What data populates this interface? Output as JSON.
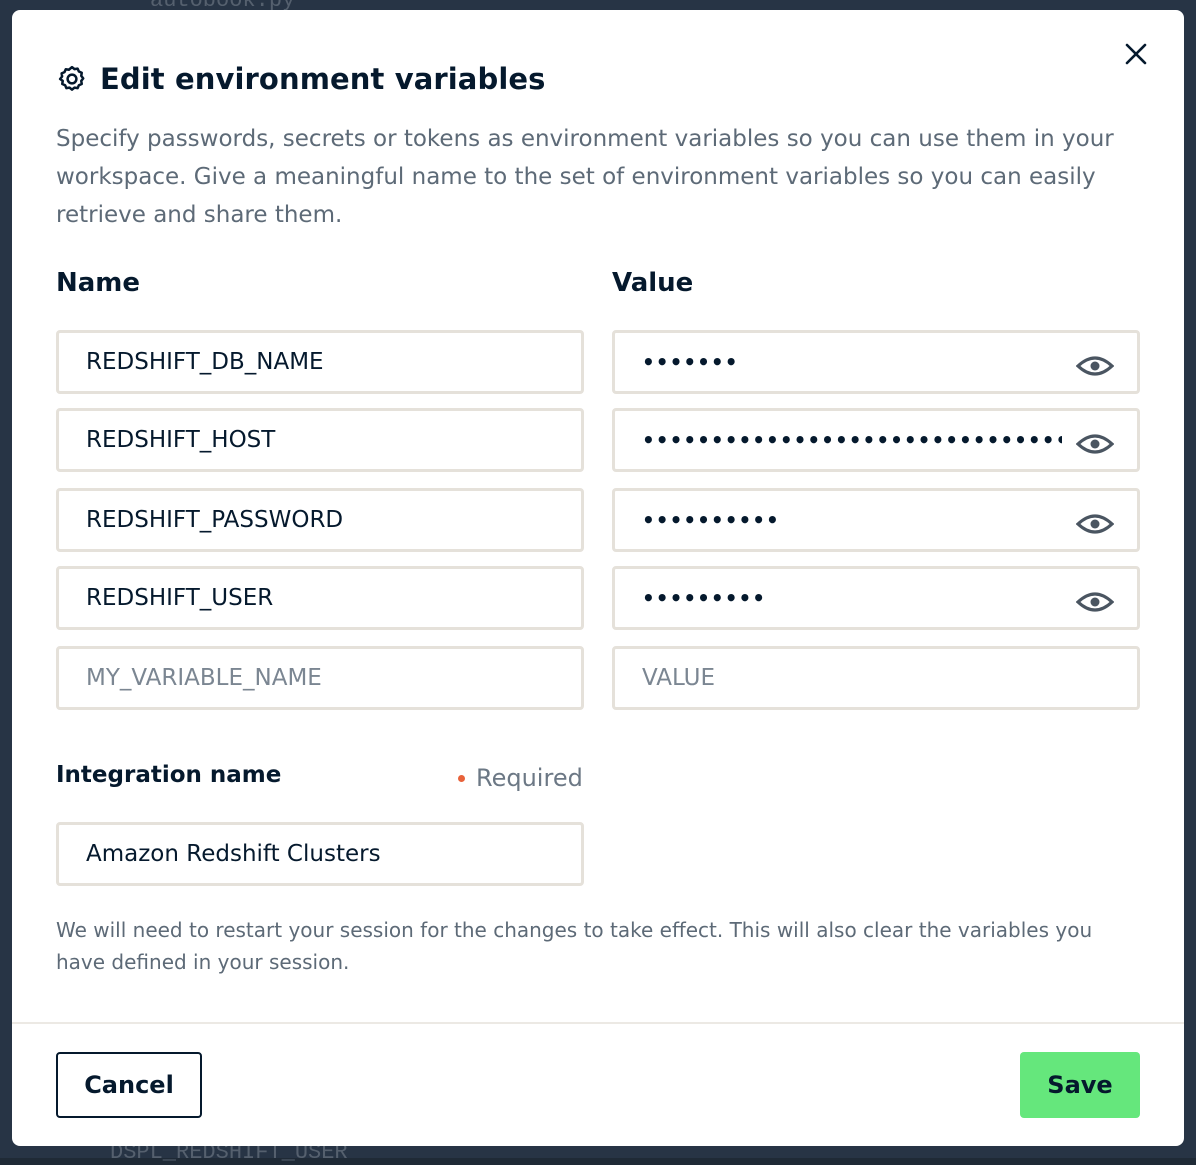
{
  "background": {
    "top_text": "autobook.py",
    "bottom_text": "DSPL_REDSHIFT_USER"
  },
  "modal": {
    "title": "Edit environment variables",
    "gear_icon": "gear-icon",
    "close_icon": "close-icon",
    "description": "Specify passwords, secrets or tokens as environment variables so you can use them in your workspace. Give a meaningful name to the set of environment variables so you can easily retrieve and share them."
  },
  "columns": {
    "name_label": "Name",
    "value_label": "Value"
  },
  "variables": [
    {
      "name": "REDSHIFT_DB_NAME",
      "value_mask": "•••••••",
      "eye_icon": "eye-icon"
    },
    {
      "name": "REDSHIFT_HOST",
      "value_mask": "••••••••••••••••••••••••••••••••••",
      "eye_icon": "eye-icon"
    },
    {
      "name": "REDSHIFT_PASSWORD",
      "value_mask": "••••••••••",
      "eye_icon": "eye-icon"
    },
    {
      "name": "REDSHIFT_USER",
      "value_mask": "•••••••••",
      "eye_icon": "eye-icon"
    }
  ],
  "new_variable": {
    "name_placeholder": "MY_VARIABLE_NAME",
    "value_placeholder": "VALUE"
  },
  "integration": {
    "label": "Integration name",
    "required_text": "Required",
    "value": "Amazon Redshift Clusters"
  },
  "footnote": "We will need to restart your session for the changes to take effect. This will also clear the variables you have defined in your session.",
  "footer": {
    "cancel_label": "Cancel",
    "save_label": "Save"
  },
  "colors": {
    "primary_text": "#05192d",
    "save_button": "#65e77c",
    "required_dot": "#e8623a",
    "field_border": "#e5e1da"
  }
}
